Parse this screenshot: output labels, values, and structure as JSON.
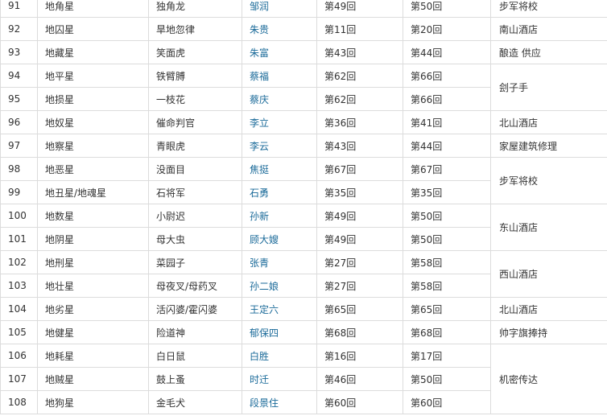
{
  "rows": [
    {
      "no": "91",
      "star": "地角星",
      "nick": "独角龙",
      "name": "邹润",
      "first": "第49回",
      "join": "第50回"
    },
    {
      "no": "92",
      "star": "地囚星",
      "nick": "旱地忽律",
      "name": "朱贵",
      "first": "第11回",
      "join": "第20回"
    },
    {
      "no": "93",
      "star": "地藏星",
      "nick": "笑面虎",
      "name": "朱富",
      "first": "第43回",
      "join": "第44回"
    },
    {
      "no": "94",
      "star": "地平星",
      "nick": "铁臂膊",
      "name": "蔡福",
      "first": "第62回",
      "join": "第66回"
    },
    {
      "no": "95",
      "star": "地损星",
      "nick": "一枝花",
      "name": "蔡庆",
      "first": "第62回",
      "join": "第66回"
    },
    {
      "no": "96",
      "star": "地奴星",
      "nick": "催命判官",
      "name": "李立",
      "first": "第36回",
      "join": "第41回"
    },
    {
      "no": "97",
      "star": "地察星",
      "nick": "青眼虎",
      "name": "李云",
      "first": "第43回",
      "join": "第44回"
    },
    {
      "no": "98",
      "star": "地恶星",
      "nick": "没面目",
      "name": "焦挺",
      "first": "第67回",
      "join": "第67回"
    },
    {
      "no": "99",
      "star": "地丑星/地魂星",
      "nick": "石将军",
      "name": "石勇",
      "first": "第35回",
      "join": "第35回"
    },
    {
      "no": "100",
      "star": "地数星",
      "nick": "小尉迟",
      "name": "孙新",
      "first": "第49回",
      "join": "第50回"
    },
    {
      "no": "101",
      "star": "地阴星",
      "nick": "母大虫",
      "name": "顾大嫂",
      "first": "第49回",
      "join": "第50回"
    },
    {
      "no": "102",
      "star": "地刑星",
      "nick": "菜园子",
      "name": "张青",
      "first": "第27回",
      "join": "第58回"
    },
    {
      "no": "103",
      "star": "地壮星",
      "nick": "母夜叉/母药叉",
      "name": "孙二娘",
      "first": "第27回",
      "join": "第58回"
    },
    {
      "no": "104",
      "star": "地劣星",
      "nick": "活闪婆/霍闪婆",
      "name": "王定六",
      "first": "第65回",
      "join": "第65回"
    },
    {
      "no": "105",
      "star": "地健星",
      "nick": "险道神",
      "name": "郁保四",
      "first": "第68回",
      "join": "第68回"
    },
    {
      "no": "106",
      "star": "地耗星",
      "nick": "白日鼠",
      "name": "白胜",
      "first": "第16回",
      "join": "第17回"
    },
    {
      "no": "107",
      "star": "地贼星",
      "nick": "鼓上蚤",
      "name": "时迁",
      "first": "第46回",
      "join": "第50回"
    },
    {
      "no": "108",
      "star": "地狗星",
      "nick": "金毛犬",
      "name": "段景住",
      "first": "第60回",
      "join": "第60回"
    }
  ],
  "roles": [
    {
      "text": "步军将校"
    },
    {
      "text": "南山酒店"
    },
    {
      "text": "酿造 供应"
    },
    {
      "text": "刽子手"
    },
    {
      "text": "北山酒店"
    },
    {
      "text": "家屋建筑修理"
    },
    {
      "text": "步军将校"
    },
    {
      "text": "东山酒店"
    },
    {
      "text": "西山酒店"
    },
    {
      "text": "北山酒店"
    },
    {
      "text": "帅字旗捧持"
    },
    {
      "text": "机密传达"
    }
  ]
}
